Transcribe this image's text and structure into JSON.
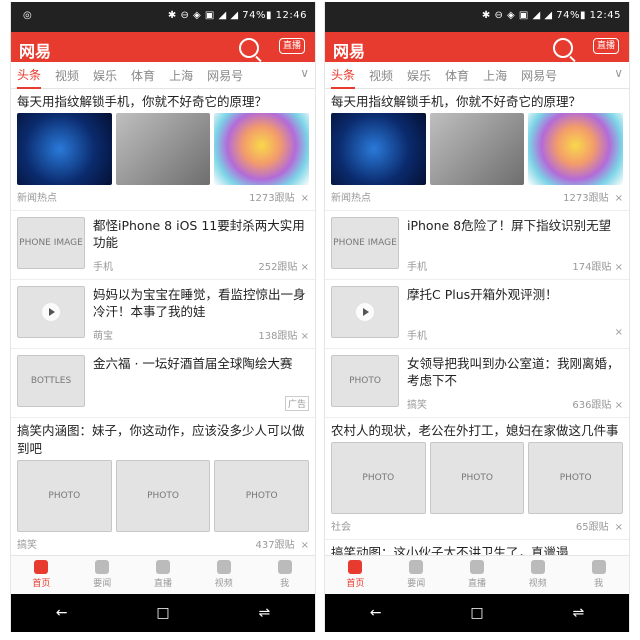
{
  "phones": [
    {
      "status": {
        "left": "◎",
        "right": "✱ ⊖ ◈ ▣ ◢ ◢ 74%▮ 12:46"
      },
      "brand": "网易",
      "live_label": "直播",
      "tabs": [
        "头条",
        "视频",
        "娱乐",
        "体育",
        "上海",
        "网易号"
      ],
      "more": "∨",
      "top_title": "每天用指纹解锁手机，你就不好奇它的原理？",
      "top_images": [
        "fingerprint",
        "phone-hand",
        "color-tree"
      ],
      "top_meta": {
        "source": "新闻热点",
        "count": "1273跟贴"
      },
      "rows": [
        {
          "title": "都怪iPhone 8 iOS 11要封杀两大实用功能",
          "source": "手机",
          "count": "252跟贴",
          "thumb": "iphone-in-hand",
          "play": false
        },
        {
          "title": "妈妈以为宝宝在睡觉，看监控惊出一身冷汗！本事了我的娃",
          "source": "萌宝",
          "count": "138跟贴",
          "thumb": "baby-video",
          "play": true
        },
        {
          "title": "金六福 · 一坛好酒首届全球陶绘大赛",
          "source": "",
          "count": "",
          "ad": "广告",
          "thumb": "liquor-bottles",
          "play": false
        }
      ],
      "bottom_title": "搞笑内涵图：妹子，你这动作，应该没多少人可以做到吧",
      "bottom_images": [
        "woman-pose-1",
        "woman-pose-2",
        "woman-portrait"
      ],
      "bottom_meta": {
        "source": "搞笑",
        "count": "437跟贴"
      },
      "nav": [
        "首页",
        "要闻",
        "直播",
        "视频",
        "我"
      ]
    },
    {
      "status": {
        "left": "",
        "right": "✱ ⊖ ◈ ▣ ◢ ◢ 74%▮ 12:45"
      },
      "brand": "网易",
      "live_label": "直播",
      "tabs": [
        "头条",
        "视频",
        "娱乐",
        "体育",
        "上海",
        "网易号"
      ],
      "more": "∨",
      "top_title": "每天用指纹解锁手机，你就不好奇它的原理？",
      "top_images": [
        "fingerprint",
        "phone-hand",
        "color-tree"
      ],
      "top_meta": {
        "source": "新闻热点",
        "count": "1273跟贴"
      },
      "rows": [
        {
          "title": "iPhone 8危险了！屏下指纹识别无望",
          "source": "手机",
          "count": "174跟贴",
          "thumb": "phone-on-table",
          "play": false
        },
        {
          "title": "摩托C Plus开箱外观评测！",
          "source": "手机",
          "count": "",
          "thumb": "phone-box-video",
          "play": true
        },
        {
          "title": "女领导把我叫到办公室道：我刚离婚，考虑下不",
          "source": "搞笑",
          "count": "636跟贴",
          "thumb": "woman-office",
          "play": false
        }
      ],
      "bottom_title": "农村人的现状，老公在外打工，媳妇在家做这几件事",
      "bottom_images": [
        "rural-house",
        "family-table",
        "cornfield"
      ],
      "bottom_meta": {
        "source": "社会",
        "count": "65跟贴"
      },
      "extra_title": "搞笑动图：这小伙子太不讲卫生了，真邋遢",
      "nav": [
        "首页",
        "要闻",
        "直播",
        "视频",
        "我"
      ]
    }
  ]
}
